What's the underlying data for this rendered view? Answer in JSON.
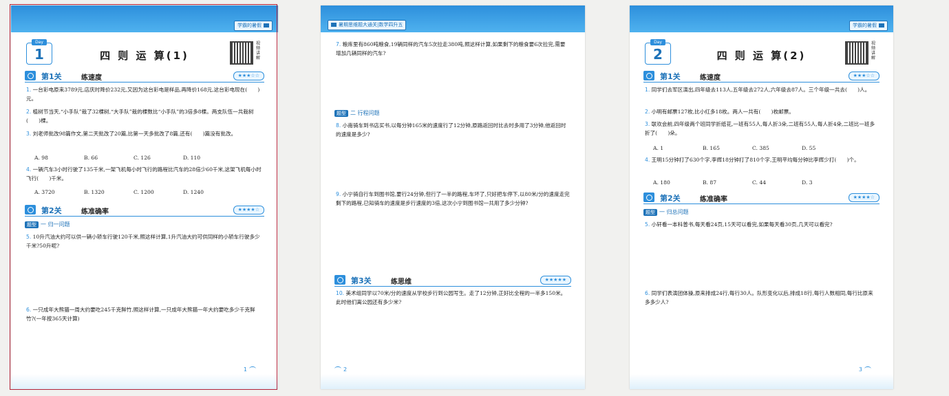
{
  "pages": [
    {
      "band_tab": "学霸的暑假",
      "day_label": "Day",
      "day_number": "1",
      "title": "四 则 运 算(1)",
      "qr_label": "视频讲解",
      "levels": [
        {
          "title": "第1关",
          "sub": "练速度",
          "stars": "★★★☆☆"
        },
        {
          "title": "第2关",
          "sub": "练准确率",
          "stars": "★★★★☆"
        }
      ],
      "qtype": {
        "tag": "题型",
        "circle": "一",
        "label": "归一问题"
      },
      "questions": [
        {
          "num": "1.",
          "text": "一台彩电原来3789元,店庆时降价232元,又因为这台彩电是样品,再降价168元,这台彩电现在(　　)元。"
        },
        {
          "num": "2.",
          "text": "植树节当天,“小手队”栽了32棵树,“大手队”栽的棵数比“小手队”的3倍多8棵。两支队伍一共栽树(　　)棵。"
        },
        {
          "num": "3.",
          "text": "刘老师批改98篇作文,第二天批改了20篇,比第一天多批改了8篇,还有(　　)篇没有批改。"
        },
        {
          "num": "4.",
          "text": "一辆汽车3小时行驶了135千米,一架飞机每小时飞行的路程比汽车的28倍少60千米,这架飞机每小时飞行(　　)千米。"
        },
        {
          "num": "5.",
          "text": "10升汽油大约可以供一辆小轿车行驶120千米,照这样计算,1升汽油大约可供同样的小轿车行驶多少千米?50升呢?"
        },
        {
          "num": "6.",
          "text": "一只成年大熊猫一周大约要吃245千克鲜竹,照这样计算,一只成年大熊猫一年大约要吃多少千克鲜竹?(一年按365天计算)"
        }
      ],
      "options_q3": [
        "A. 98",
        "B. 66",
        "C. 126",
        "D. 110"
      ],
      "options_q4": [
        "A. 3720",
        "B. 1320",
        "C. 1200",
        "D. 1240"
      ],
      "page_number": "1"
    },
    {
      "band_tab": "暑期思维题大通关|数学四升五",
      "qtype": {
        "tag": "题型",
        "circle": "二",
        "label": "行程问题"
      },
      "level": {
        "title": "第3关",
        "sub": "练思维",
        "stars": "★★★★★"
      },
      "questions": [
        {
          "num": "7.",
          "text": "粮库里有860吨粮食,19辆同样的汽车5次拉走380吨,照这样计算,如果剩下的粮食要6次拉完,需要增加几辆同样的汽车?"
        },
        {
          "num": "8.",
          "text": "小南骑车到书店买书,以每分钟165米的速度行了12分钟,原路返回时比去时多用了3分钟,他返回时的速度是多少?"
        },
        {
          "num": "9.",
          "text": "小宁骑自行车到图书馆,要行24分钟,但行了一半的路程,车坏了,只好把车停下,以80米/分的速度走完剩下的路程,已知骑车的速度是步行速度的3倍,这次小宁到图书馆一共用了多少分钟?"
        },
        {
          "num": "10.",
          "text": "美术组同学以70米/分的速度从学校步行到公园写生。走了12分钟,正好比全程的一半多150米。此时他们离公园还有多少米?"
        }
      ],
      "page_number": "2"
    },
    {
      "band_tab": "学霸的暑假",
      "day_label": "Day",
      "day_number": "2",
      "title": "四 则 运 算(2)",
      "qr_label": "视频讲解",
      "levels": [
        {
          "title": "第1关",
          "sub": "练速度",
          "stars": "★★★☆☆"
        },
        {
          "title": "第2关",
          "sub": "练准确率",
          "stars": "★★★★☆"
        }
      ],
      "qtype": {
        "tag": "题型",
        "circle": "一",
        "label": "归总问题"
      },
      "questions": [
        {
          "num": "1.",
          "text": "同学们去军区演出,四年级去113人,五年级去272人,六年级去87人。三个年级一共去(　　)人。"
        },
        {
          "num": "2.",
          "text": "小明有邮票127枚,比小红多18枚。两人一共有(　　)枚邮票。"
        },
        {
          "num": "3.",
          "text": "联欢会前,四年级两个班同学折纸花,一班有55人,每人折3朵,二班有55人,每人折4朵,二班比一班多折了(　　)朵。"
        },
        {
          "num": "4.",
          "text": "王明15分钟打了630个字,李辉18分钟打了810个字,王明平均每分钟比李辉少打(　　)个。"
        },
        {
          "num": "5.",
          "text": "小轩看一本科普书,每天看24页,15天可以看完,如果每天看30页,几天可以看完?"
        },
        {
          "num": "6.",
          "text": "同学们表演团体操,原来排成24行,每行30人。队形变化以后,排成18行,每行人数相同,每行比原来多多少人?"
        }
      ],
      "options_q3": [
        "A. 1",
        "B. 165",
        "C. 385",
        "D. 55"
      ],
      "options_q4": [
        "A. 180",
        "B. 87",
        "C. 44",
        "D. 3"
      ],
      "page_number": "3"
    }
  ]
}
